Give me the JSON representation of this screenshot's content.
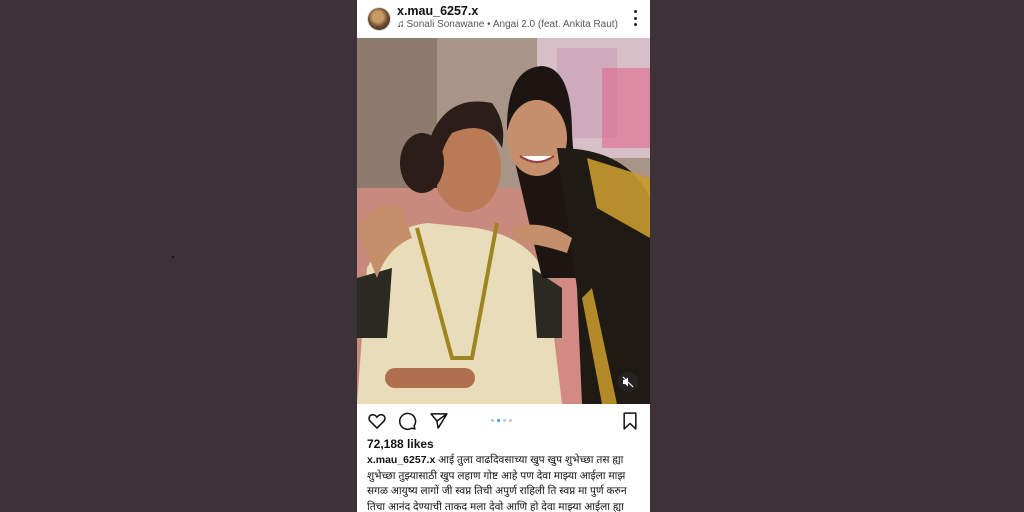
{
  "post": {
    "username": "x.mau_6257.x",
    "music_line": "Sonali Sonawane • Angai 2.0 (feat. Ankita Raut)",
    "likes": "72,188 likes",
    "caption_user": "x.mau_6257.x",
    "caption_text": "आई तुला वाढदिवसाच्या खुप खुप शुभेच्छा तस ह्या\nशुभेच्छा तुझ्यासाठी खुप लहाण गोष्ट आहे पण देवा माझ्या आईला माझ\nसगळ आयुष्य लागों जी स्वप्न तिची अपुर्ण राहिली ति स्वप्न मा पुर्ण करुन\nतिचा आनंद देण्याची ताकद मला देवो आणि हो देवा माझ्या आईला ह्या"
  },
  "icons": {
    "music": "music-note-icon",
    "more": "more-vertical-icon",
    "like": "heart-icon",
    "comment": "comment-icon",
    "share": "send-icon",
    "save": "bookmark-icon",
    "mute": "muted-icon"
  },
  "carousel": {
    "count": 4,
    "active": 1
  }
}
